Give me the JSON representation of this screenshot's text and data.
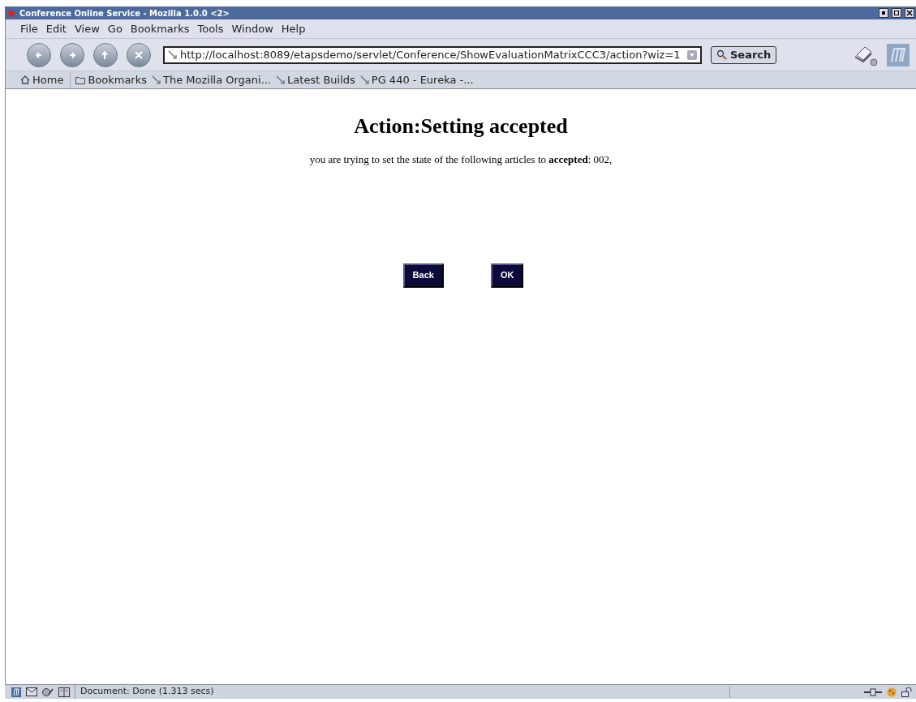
{
  "window": {
    "title": "Conference Online Service - Mozilla 1.0.0 <2>"
  },
  "menu": [
    "File",
    "Edit",
    "View",
    "Go",
    "Bookmarks",
    "Tools",
    "Window",
    "Help"
  ],
  "navigation": {
    "url": "http://localhost:8089/etapsdemo/servlet/Conference/ShowEvaluationMatrixCCC3/action?wiz=1",
    "search_button": "Search"
  },
  "personal_toolbar": [
    {
      "kind": "home",
      "label": "Home"
    },
    {
      "kind": "folder",
      "label": "Bookmarks"
    },
    {
      "kind": "link",
      "label": "The Mozilla Organi..."
    },
    {
      "kind": "link",
      "label": "Latest Builds"
    },
    {
      "kind": "link",
      "label": "PG 440 - Eureka -..."
    }
  ],
  "page": {
    "heading": "Action:Setting accepted",
    "message": "you are trying to set the state of the following articles to **accepted**: 002,",
    "buttons": [
      "Back",
      "OK"
    ]
  },
  "status_bar": {
    "text": "Document: Done (1.313 secs)"
  }
}
